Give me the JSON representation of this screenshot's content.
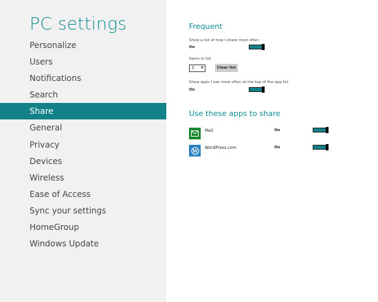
{
  "app_title": "PC settings",
  "nav": {
    "items": [
      {
        "label": "Personalize"
      },
      {
        "label": "Users"
      },
      {
        "label": "Notifications"
      },
      {
        "label": "Search"
      },
      {
        "label": "Share"
      },
      {
        "label": "General"
      },
      {
        "label": "Privacy"
      },
      {
        "label": "Devices"
      },
      {
        "label": "Wireless"
      },
      {
        "label": "Ease of Access"
      },
      {
        "label": "Sync your settings"
      },
      {
        "label": "HomeGroup"
      },
      {
        "label": "Windows Update"
      }
    ],
    "selected": "Share"
  },
  "frequent": {
    "title": "Frequent",
    "show_list_label": "Show a list of how I share most often",
    "show_list_state": "On",
    "items_in_list_label": "Items in list",
    "items_in_list_value": "5",
    "clear_list_label": "Clear list",
    "show_apps_label": "Show apps I use most often at the top of the app list",
    "show_apps_state": "On"
  },
  "share_apps": {
    "title": "Use these apps to share",
    "apps": [
      {
        "name": "Mail",
        "state": "On",
        "icon": "mail-icon"
      },
      {
        "name": "WordPress.com",
        "state": "On",
        "icon": "wordpress-icon"
      }
    ]
  },
  "colors": {
    "accent": "#128188",
    "title": "#108c93",
    "left_pane": "#f1f1f1",
    "mail_tile": "#1b8a2f",
    "wordpress_tile": "#2a7fbd"
  }
}
